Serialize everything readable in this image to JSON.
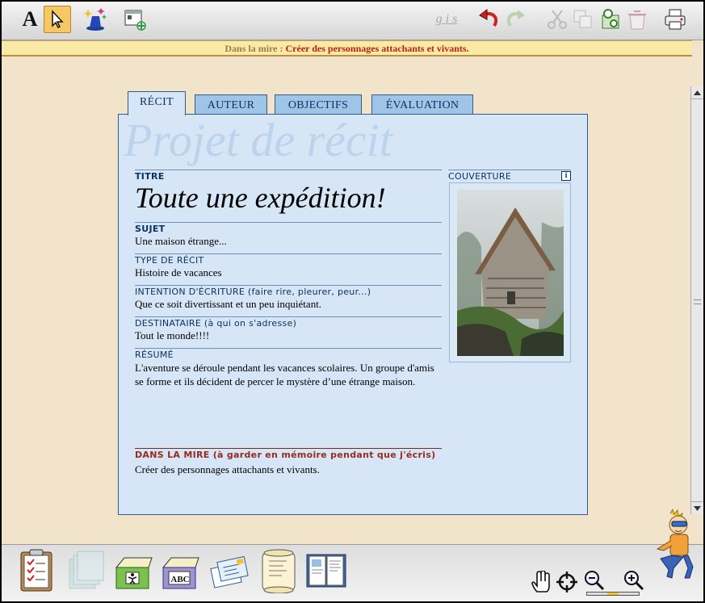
{
  "toolbar": {
    "text_tool": "A",
    "greyed_styles": "g i s"
  },
  "notice": {
    "label": "Dans la mire :",
    "text": "Créer des personnages attachants et vivants."
  },
  "tabs": [
    "RÉCIT",
    "AUTEUR",
    "OBJECTIFS",
    "ÉVALUATION"
  ],
  "panel": {
    "watermark": "Projet de récit",
    "titre_label": "TITRE",
    "titre": "Toute une expédition!",
    "sujet_label": "SUJET",
    "sujet": "Une maison étrange...",
    "type_label": "TYPE DE RÉCIT",
    "type": "Histoire de vacances",
    "intention_label": "INTENTION D'ÉCRITURE (faire rire, pleurer, peur...)",
    "intention": "Que ce soit divertissant et un peu inquiétant.",
    "destinataire_label": "DESTINATAIRE (à qui on s'adresse)",
    "destinataire": "Tout le monde!!!!",
    "resume_label": "RÉSUMÉ",
    "resume": "L'aventure se déroule pendant les vacances scolaires. Un groupe d'amis se forme et ils décident de percer le mystère d’une étrange maison.",
    "mire_label": "DANS LA MIRE (à garder en mémoire pendant que j'écris)",
    "mire": "Créer des personnages attachants et vivants.",
    "couverture_label": "COUVERTURE",
    "info": "i"
  },
  "bottom": {
    "tray_label": "ABC"
  },
  "colors": {
    "background": "#f1e4cb",
    "panel": "#d6e6f6",
    "tab": "#9ec4e6",
    "accent": "#0c3263",
    "notice_text": "#b8230d"
  },
  "icons": [
    "text-tool-icon",
    "pointer-icon",
    "magic-hat-icon",
    "new-frame-icon",
    "undo-icon",
    "redo-icon",
    "cut-icon",
    "copy-icon",
    "paste-icon",
    "trash-icon",
    "print-icon",
    "clipboard-icon",
    "stack-icon",
    "card-tray-icon",
    "abc-tray-icon",
    "cards-icon",
    "scroll-icon",
    "book-icon",
    "hand-icon",
    "target-icon",
    "zoom-out-icon",
    "zoom-in-icon",
    "mascot-icon"
  ]
}
